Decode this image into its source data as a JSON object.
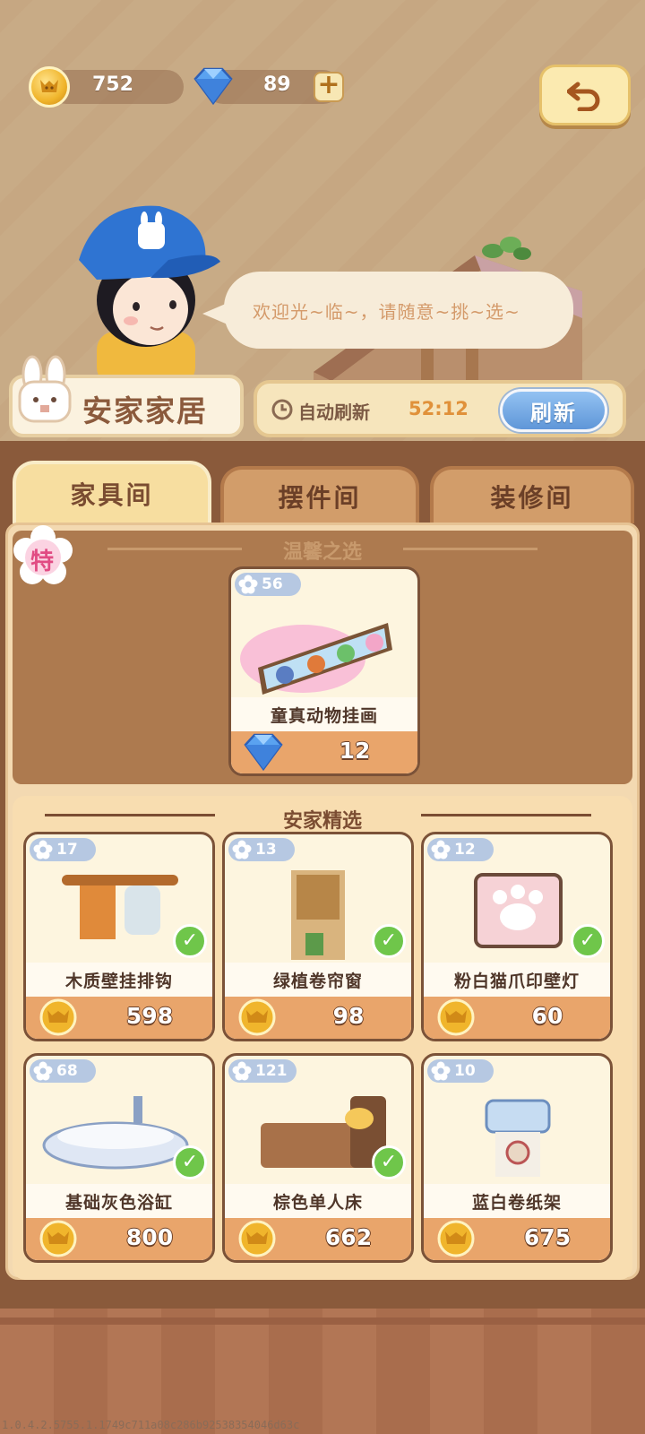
{
  "currency": {
    "coins": "752",
    "gems": "89"
  },
  "dialog": {
    "text": "欢迎光~临~，请随意~挑~选~"
  },
  "shop": {
    "name": "安家家居"
  },
  "refresh": {
    "label": "自动刷新",
    "timer": "52:12",
    "button": "刷新"
  },
  "tabs": [
    {
      "label": "家具间",
      "active": true
    },
    {
      "label": "摆件间",
      "active": false
    },
    {
      "label": "装修间",
      "active": false
    }
  ],
  "special_section": {
    "title": "温馨之选",
    "badge": "特",
    "item": {
      "name": "童真动物挂画",
      "stock": "56",
      "price": "12",
      "currency": "gem"
    }
  },
  "main_section": {
    "title": "安家精选",
    "items": [
      {
        "name": "木质壁挂排钩",
        "stock": "17",
        "price": "598",
        "owned": true
      },
      {
        "name": "绿植卷帘窗",
        "stock": "13",
        "price": "98",
        "owned": true
      },
      {
        "name": "粉白猫爪印壁灯",
        "stock": "12",
        "price": "60",
        "owned": true
      },
      {
        "name": "基础灰色浴缸",
        "stock": "68",
        "price": "800",
        "owned": true
      },
      {
        "name": "棕色单人床",
        "stock": "121",
        "price": "662",
        "owned": true
      },
      {
        "name": "蓝白卷纸架",
        "stock": "10",
        "price": "675",
        "owned": false
      }
    ]
  },
  "footer": {
    "version": "1.0.4.2.5755.1.1749c711a08c286b92538354046d63c"
  },
  "colors": {
    "accent_blue": "#5f96d8",
    "coin_gold": "#f0b52c",
    "check_green": "#6fc64a",
    "special_pink": "#e14b83"
  },
  "icons": [
    "coin-icon",
    "gem-icon",
    "plus-icon",
    "back-arrow-icon",
    "clock-icon",
    "flower-icon",
    "check-icon",
    "bunny-icon"
  ]
}
